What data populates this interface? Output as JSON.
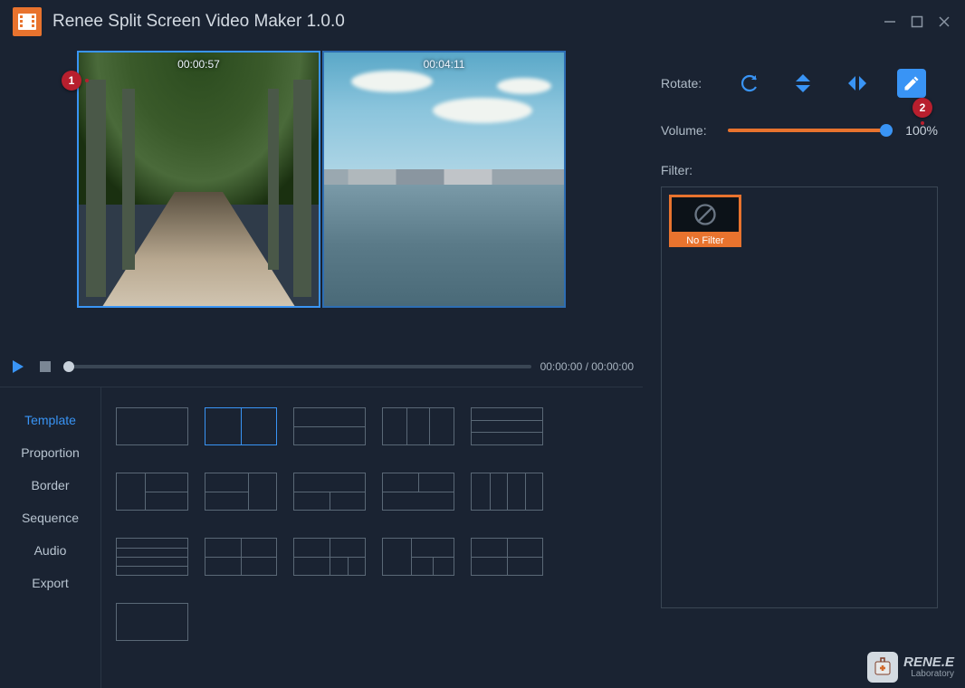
{
  "app": {
    "title": "Renee Split Screen Video Maker 1.0.0"
  },
  "badges": {
    "one": "1",
    "two": "2"
  },
  "preview": {
    "clip1_ts": "00:00:57",
    "clip2_ts": "00:04:11"
  },
  "playback": {
    "timer": "00:00:00 / 00:00:00"
  },
  "tabs": {
    "template": "Template",
    "proportion": "Proportion",
    "border": "Border",
    "sequence": "Sequence",
    "audio": "Audio",
    "export": "Export"
  },
  "right": {
    "rotate_label": "Rotate:",
    "volume_label": "Volume:",
    "volume_value": "100%",
    "filter_label": "Filter:",
    "no_filter": "No Filter"
  },
  "brand": {
    "name": "RENE.E",
    "sub": "Laboratory"
  }
}
